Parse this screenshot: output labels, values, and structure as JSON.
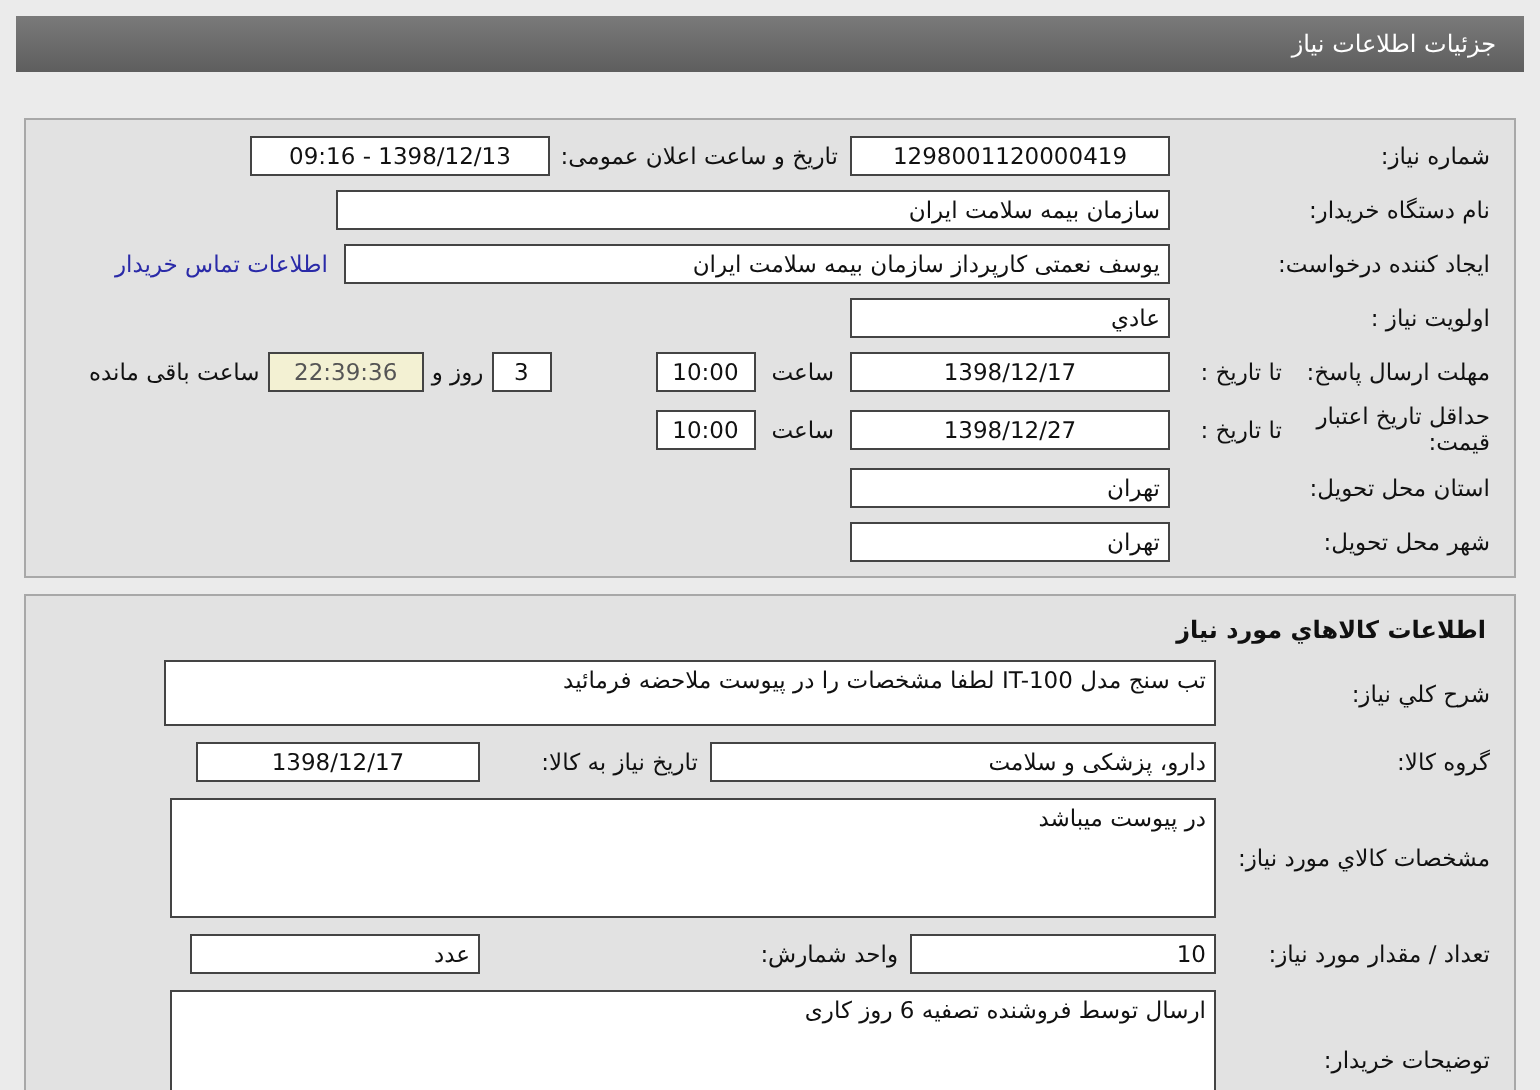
{
  "header": {
    "title": "جزئیات اطلاعات نیاز"
  },
  "need": {
    "need_number": {
      "label": "شماره نیاز:",
      "value": "1298001120000419"
    },
    "announce": {
      "label": "تاریخ و ساعت اعلان عمومی:",
      "value": "1398/12/13 - 09:16"
    },
    "buyer_org": {
      "label": "نام دستگاه خریدار:",
      "value": "سازمان بیمه سلامت ایران"
    },
    "requester": {
      "label": "ایجاد کننده درخواست:",
      "value": "یوسف نعمتی کارپرداز سازمان بیمه سلامت ایران",
      "contact_link": "اطلاعات تماس خریدار"
    },
    "priority": {
      "label": "اولویت نیاز :",
      "value": "عادي"
    },
    "deadline": {
      "label": "مهلت ارسال پاسخ:",
      "sublabel": "تا تاریخ :",
      "date": "1398/12/17",
      "time_label": "ساعت",
      "time": "10:00",
      "days": "3",
      "days_label": "روز و",
      "remaining": "22:39:36",
      "remaining_label": "ساعت باقی مانده"
    },
    "validity": {
      "label": "حداقل تاریخ اعتبار قیمت:",
      "sublabel": "تا تاریخ :",
      "date": "1398/12/27",
      "time_label": "ساعت",
      "time": "10:00"
    },
    "province": {
      "label": "استان محل تحویل:",
      "value": "تهران"
    },
    "city": {
      "label": "شهر محل تحویل:",
      "value": "تهران"
    }
  },
  "goods": {
    "title": "اطلاعات کالاهاي مورد نياز",
    "description": {
      "label": "شرح کلي نياز:",
      "value": "تب سنج مدل IT-100 لطفا مشخصات را در پیوست ملاحضه فرمائید"
    },
    "group": {
      "label": "گروه کالا:",
      "value": "دارو، پزشکی و سلامت",
      "date_label": "تاریخ نیاز به کالا:",
      "date": "1398/12/17"
    },
    "specs": {
      "label": "مشخصات کالاي مورد نياز:",
      "value": "در پیوست میباشد"
    },
    "quantity": {
      "label": "تعداد / مقدار مورد نیاز:",
      "value": "10",
      "unit_label": "واحد شمارش:",
      "unit": "عدد"
    },
    "buyer_notes": {
      "label": "توضیحات خریدار:",
      "value": "ارسال توسط فروشنده تصفیه 6 روز کاری"
    }
  }
}
